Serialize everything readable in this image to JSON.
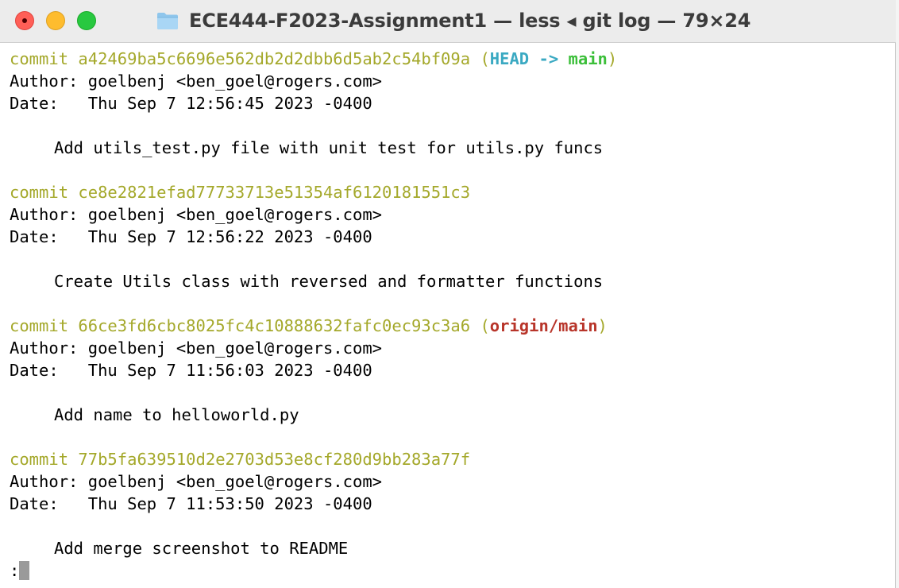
{
  "window": {
    "title": "ECE444-F2023-Assignment1 — less ◂ git log — 79×24"
  },
  "log": [
    {
      "commit_word": "commit",
      "hash": "a42469ba5c6696e562db2d2dbb6d5ab2c54bf09a",
      "open_paren": "(",
      "head": "HEAD",
      "arrow": "->",
      "branch": "main",
      "close_paren": ")",
      "author": "Author: goelbenj <ben_goel@rogers.com>",
      "date": "Date:   Thu Sep 7 12:56:45 2023 -0400",
      "message": "Add utils_test.py file with unit test for utils.py funcs"
    },
    {
      "commit_word": "commit",
      "hash": "ce8e2821efad77733713e51354af6120181551c3",
      "author": "Author: goelbenj <ben_goel@rogers.com>",
      "date": "Date:   Thu Sep 7 12:56:22 2023 -0400",
      "message": "Create Utils class with reversed and formatter functions"
    },
    {
      "commit_word": "commit",
      "hash": "66ce3fd6cbc8025fc4c10888632fafc0ec93c3a6",
      "open_paren": "(",
      "remote": "origin/main",
      "close_paren": ")",
      "author": "Author: goelbenj <ben_goel@rogers.com>",
      "date": "Date:   Thu Sep 7 11:56:03 2023 -0400",
      "message": "Add name to helloworld.py"
    },
    {
      "commit_word": "commit",
      "hash": "77b5fa639510d2e2703d53e8cf280d9bb283a77f",
      "author": "Author: goelbenj <ben_goel@rogers.com>",
      "date": "Date:   Thu Sep 7 11:53:50 2023 -0400",
      "message": "Add merge screenshot to README"
    }
  ],
  "prompt": ":",
  "colors": {
    "commit_hash": "#a4a82a",
    "head_ref": "#3aa9c2",
    "branch_ref": "#3cbf3a",
    "remote_ref": "#b8352a"
  },
  "icons": {
    "title": "folder-icon",
    "close": "close-button",
    "minimize": "minimize-button",
    "zoom": "zoom-button"
  }
}
